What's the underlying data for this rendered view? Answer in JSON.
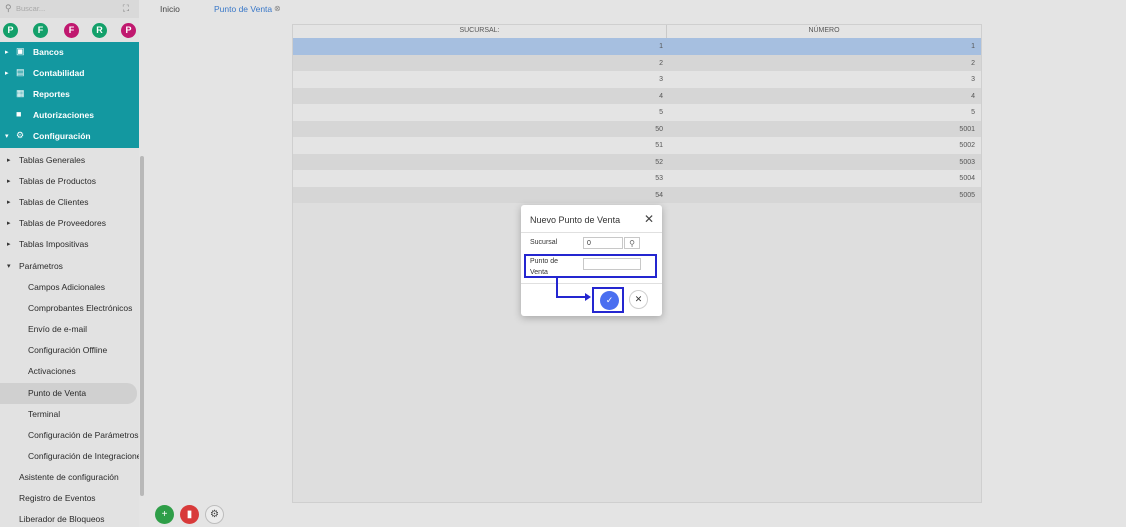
{
  "search": {
    "placeholder": "Buscar..."
  },
  "avatars": [
    {
      "letter": "P",
      "color": "#13a06a"
    },
    {
      "letter": "F",
      "color": "#13a06a"
    },
    {
      "letter": "F",
      "color": "#c0186f"
    },
    {
      "letter": "R",
      "color": "#13a06a"
    },
    {
      "letter": "P",
      "color": "#c0186f"
    }
  ],
  "sidebar": {
    "modules": [
      {
        "label": "Bancos",
        "icon": "briefcase-icon"
      },
      {
        "label": "Contabilidad",
        "icon": "ledger-icon"
      },
      {
        "label": "Reportes",
        "icon": "report-icon"
      },
      {
        "label": "Autorizaciones",
        "icon": "lock-icon"
      },
      {
        "label": "Configuración",
        "icon": "gears-icon"
      }
    ],
    "items": [
      "Tablas Generales",
      "Tablas de Productos",
      "Tablas de Clientes",
      "Tablas de Proveedores",
      "Tablas Impositivas",
      "Parámetros",
      "Campos Adicionales",
      "Comprobantes Electrónicos",
      "Envío de e-mail",
      "Configuración Offline",
      "Activaciones",
      "Punto de Venta",
      "Terminal",
      "Configuración de Parámetros",
      "Configuración de Integraciones",
      "Asistente de configuración",
      "Registro de Eventos",
      "Liberador de Bloqueos"
    ]
  },
  "tabs": {
    "home": "Inicio",
    "active": "Punto de Venta"
  },
  "table": {
    "headers": [
      "SUCURSAL:",
      "NÚMERO"
    ],
    "rows": [
      [
        "1",
        "1"
      ],
      [
        "2",
        "2"
      ],
      [
        "3",
        "3"
      ],
      [
        "4",
        "4"
      ],
      [
        "5",
        "5"
      ],
      [
        "50",
        "5001"
      ],
      [
        "51",
        "5002"
      ],
      [
        "52",
        "5003"
      ],
      [
        "53",
        "5004"
      ],
      [
        "54",
        "5005"
      ]
    ]
  },
  "modal": {
    "title": "Nuevo Punto de Venta",
    "sucursal_label": "Sucursal",
    "sucursal_value": "0",
    "pv_label_1": "Punto de",
    "pv_label_2": "Venta"
  },
  "colors": {
    "teal": "#1398a0",
    "selected_row": "#a6bfe0",
    "add": "#2e9e48",
    "delete": "#d83a3a",
    "confirm": "#4a6ff0",
    "annotation": "#2426d0"
  }
}
